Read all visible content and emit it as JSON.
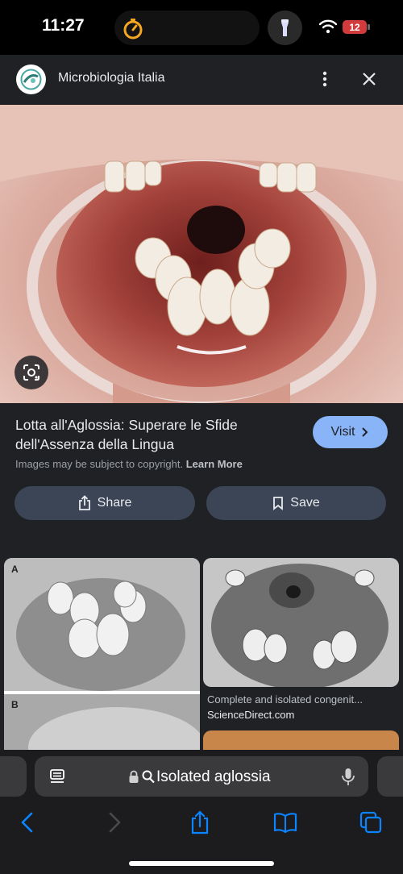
{
  "status_bar": {
    "time": "11:27",
    "battery": "12"
  },
  "header": {
    "site_name": "Microbiologia Italia",
    "more_icon": "more-vertical-icon",
    "close_icon": "close-icon"
  },
  "image_panel": {
    "title": "Lotta all'Aglossia: Superare le Sfide dell'Assenza della Lingua",
    "visit_label": "Visit",
    "copyright_text": "Images may be subject to copyright.",
    "learn_more": "Learn More",
    "share_label": "Share",
    "save_label": "Save",
    "lens_icon": "lens-icon"
  },
  "results": [
    {
      "title": "",
      "source": ""
    },
    {
      "title": "Complete and isolated congenit...",
      "source": "ScienceDirect.com"
    }
  ],
  "figure_labels": {
    "a": "A",
    "b": "B"
  },
  "address_bar": {
    "query": "Isolated aglossia"
  },
  "colors": {
    "accent": "#8ab4f8",
    "panel": "#202124",
    "button": "#3c4556",
    "toolbar": "#1c1c1e",
    "ios_blue": "#0a84ff"
  }
}
